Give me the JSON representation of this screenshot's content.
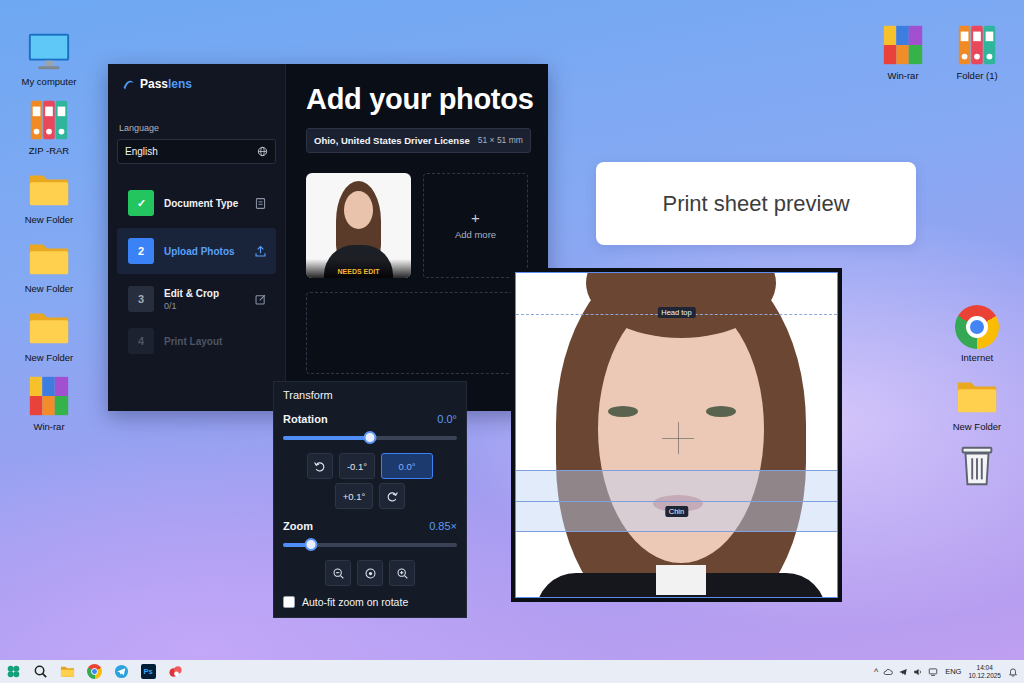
{
  "desktop": {
    "icons_left": [
      {
        "label": "My computer",
        "kind": "monitor"
      },
      {
        "label": "ZIP -RAR",
        "kind": "binders"
      },
      {
        "label": "New Folder",
        "kind": "folder"
      },
      {
        "label": "New Folder",
        "kind": "folder"
      },
      {
        "label": "New Folder",
        "kind": "folder"
      },
      {
        "label": "Win-rar",
        "kind": "archive"
      }
    ],
    "icons_top_right": [
      {
        "label": "Win-rar",
        "kind": "archive"
      },
      {
        "label": "Folder (1)",
        "kind": "binders"
      }
    ],
    "icons_right": [
      {
        "label": "Internet",
        "kind": "chrome"
      },
      {
        "label": "New Folder",
        "kind": "folder"
      },
      {
        "kind": "trash"
      }
    ]
  },
  "app": {
    "logo": {
      "part1": "Pass",
      "part2": "lens"
    },
    "language": {
      "label": "Language",
      "value": "English"
    },
    "steps": [
      {
        "number": "✓",
        "label": "Document Type",
        "done": true,
        "selected": false,
        "disabled": false
      },
      {
        "number": "2",
        "label": "Upload Photos",
        "done": false,
        "selected": true,
        "disabled": false
      },
      {
        "number": "3",
        "label": "Edit & Crop",
        "sub": "0/1",
        "done": false,
        "selected": false,
        "disabled": false
      },
      {
        "number": "4",
        "label": "Print Layout",
        "done": false,
        "selected": false,
        "disabled": true
      }
    ],
    "title": "Add your photos",
    "document": {
      "name": "Ohio, United States Driver License",
      "size": "51 × 51 mm"
    },
    "photos": [
      {
        "badge": "NEEDS EDIT"
      }
    ],
    "add_more": {
      "icon": "+",
      "label": "Add more"
    }
  },
  "transform": {
    "title": "Transform",
    "rotation": {
      "label": "Rotation",
      "reading": "0.0°",
      "level": 0.5,
      "buttons": [
        {
          "label": "-0.1°",
          "selected": false
        },
        {
          "label": "0.0°",
          "selected": true
        },
        {
          "label": "+0.1°",
          "selected": false
        }
      ]
    },
    "zoom": {
      "label": "Zoom",
      "reading": "0.85×",
      "level": 0.16
    },
    "autofit": {
      "label": "Auto-fit zoom on rotate",
      "checked": false
    }
  },
  "editor": {
    "guides": [
      {
        "label": "Head top"
      },
      {
        "label": "Chin"
      }
    ]
  },
  "print_preview": {
    "title": "Print sheet preview"
  },
  "taskbar": {
    "apps": [
      {
        "kind": "start"
      },
      {
        "kind": "search"
      },
      {
        "kind": "folder"
      },
      {
        "kind": "chrome"
      },
      {
        "kind": "telegram"
      },
      {
        "kind": "photoshop",
        "label": "Ps"
      },
      {
        "kind": "app"
      }
    ],
    "tray": {
      "chevron": "^",
      "language": "ENG",
      "time": "14:04",
      "date": "10.12.2025"
    }
  }
}
